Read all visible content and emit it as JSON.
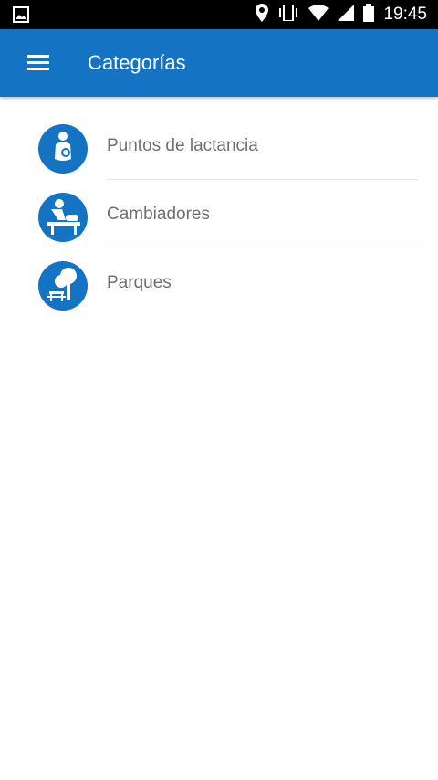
{
  "status_bar": {
    "time": "19:45",
    "icons": [
      "image-icon",
      "location-icon",
      "vibrate-icon",
      "wifi-icon",
      "signal-icon",
      "battery-icon"
    ]
  },
  "app_bar": {
    "title": "Categorías",
    "menu_icon": "menu-icon",
    "color": "#1473c2"
  },
  "categories": [
    {
      "label": "Puntos de lactancia",
      "icon": "breastfeeding-icon"
    },
    {
      "label": "Cambiadores",
      "icon": "changing-table-icon"
    },
    {
      "label": "Parques",
      "icon": "park-icon"
    }
  ],
  "colors": {
    "accent": "#1473c2",
    "text_secondary": "#6f6f6f",
    "divider": "#e4e4e4"
  }
}
